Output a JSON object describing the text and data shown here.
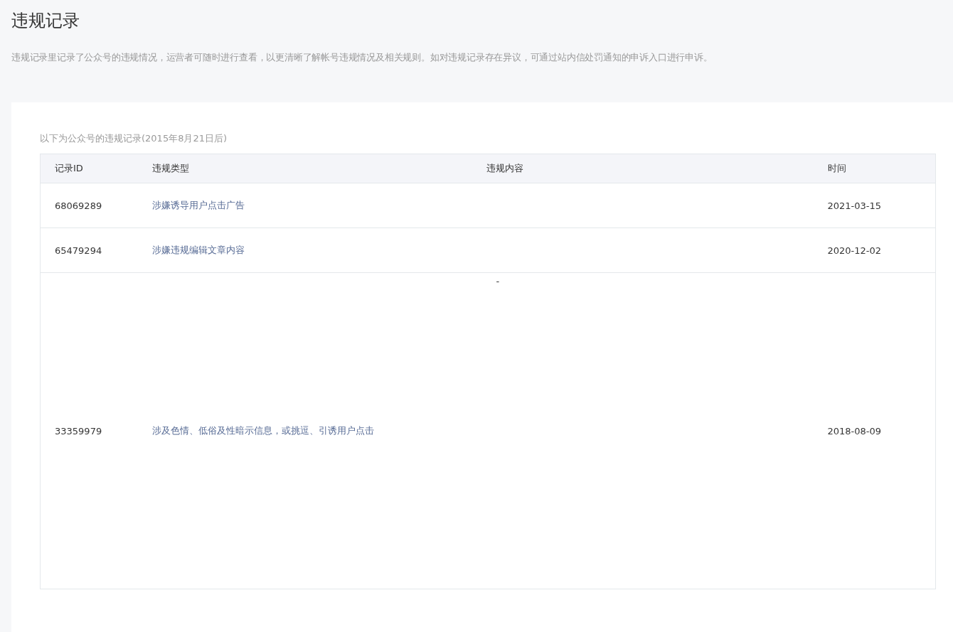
{
  "page_title": "违规记录",
  "description": "违规记录里记录了公众号的违规情况，运营者可随时进行查看，以更清晰了解帐号违规情况及相关规则。如对违规记录存在异议，可通过站内信处罚通知的申诉入口进行申诉。",
  "table": {
    "caption": "以下为公众号的违规记录(2015年8月21日后)",
    "columns": [
      "记录ID",
      "违规类型",
      "违规内容",
      "时间"
    ],
    "rows": [
      {
        "id": "68069289",
        "type": "涉嫌诱导用户点击广告",
        "time": "2021-03-15"
      },
      {
        "id": "65479294",
        "type": "涉嫌违规编辑文章内容",
        "time": "2020-12-02"
      },
      {
        "id": "33359979",
        "type": "涉及色情、低俗及性暗示信息，或挑逗、引诱用户点击",
        "content": "-",
        "time": "2018-08-09"
      }
    ]
  }
}
